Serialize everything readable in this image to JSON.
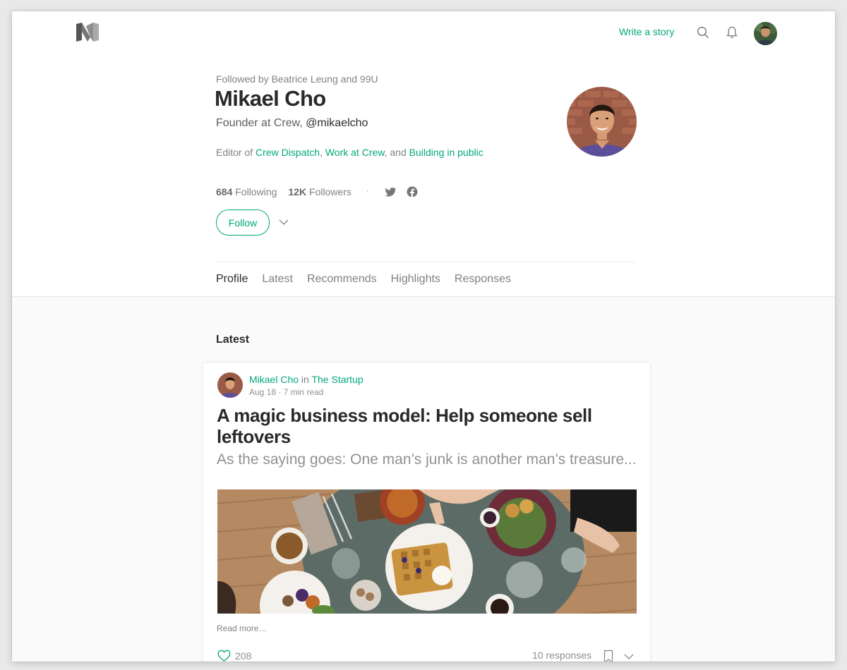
{
  "navbar": {
    "logo": "medium-logo-icon",
    "write_story": "Write a story",
    "icons": [
      "search-icon",
      "bell-icon"
    ],
    "avatar": "user-avatar"
  },
  "profile": {
    "followed_by": "Followed by Beatrice Leung and 99U",
    "name": "Mikael Cho",
    "bio_prefix": "Founder at Crew, ",
    "handle": "@mikaelcho",
    "editor_prefix": "Editor of ",
    "publications": [
      "Crew Dispatch",
      "Work at Crew",
      "Building in public"
    ],
    "editor_sep1": ", ",
    "editor_sep2": ", and ",
    "following_count": "684",
    "following_label": " Following",
    "followers_count": "12K",
    "followers_label": " Followers",
    "dot": "·",
    "social_icons": [
      "twitter-icon",
      "facebook-icon"
    ],
    "follow_button": "Follow"
  },
  "tabs": [
    {
      "label": "Profile",
      "active": true
    },
    {
      "label": "Latest",
      "active": false
    },
    {
      "label": "Recommends",
      "active": false
    },
    {
      "label": "Highlights",
      "active": false
    },
    {
      "label": "Responses",
      "active": false
    }
  ],
  "latest": {
    "section_title": "Latest",
    "post": {
      "author": "Mikael Cho",
      "in_label": " in ",
      "publication": "The Startup",
      "date": "Aug 18",
      "read_time": "7 min read",
      "meta_sep": " · ",
      "title": "A magic business model: Help someone sell leftovers",
      "subtitle": "As the saying goes: One man’s junk is another man’s treasure...",
      "read_more": "Read more…",
      "claps": "208",
      "responses": "10 responses"
    }
  },
  "colors": {
    "accent": "#03a87c",
    "page_background": "#fafafa",
    "header_background": "#ffffff"
  }
}
